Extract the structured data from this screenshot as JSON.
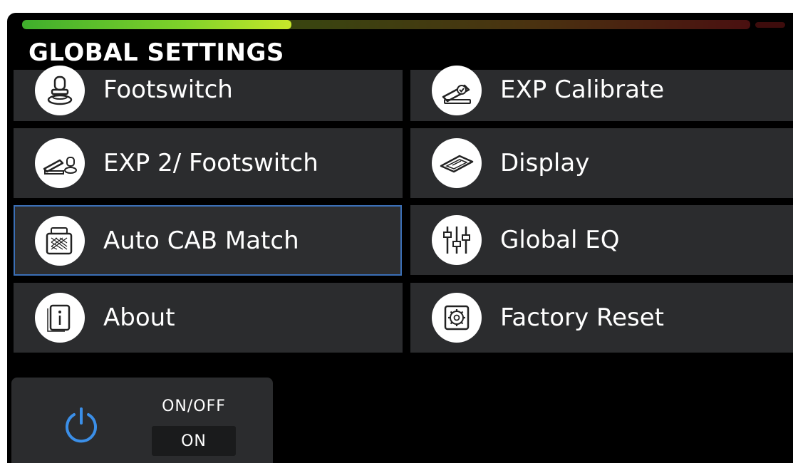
{
  "header": {
    "title": "GLOBAL SETTINGS"
  },
  "level_meter": {
    "fill_fraction": 0.37
  },
  "menu": {
    "items": [
      {
        "label": "Footswitch",
        "icon": "footswitch-icon"
      },
      {
        "label": "EXP Calibrate",
        "icon": "exp-calibrate-icon"
      },
      {
        "label": "EXP 2/ Footswitch",
        "icon": "exp-footswitch-icon"
      },
      {
        "label": "Display",
        "icon": "display-icon"
      },
      {
        "label": "Auto CAB Match",
        "icon": "cab-icon",
        "selected": true
      },
      {
        "label": "Global EQ",
        "icon": "eq-sliders-icon"
      },
      {
        "label": "About",
        "icon": "info-icon"
      },
      {
        "label": "Factory Reset",
        "icon": "factory-reset-icon"
      }
    ]
  },
  "power": {
    "label": "ON/OFF",
    "value": "ON",
    "icon": "power-icon"
  },
  "colors": {
    "background": "#000000",
    "tile": "#2b2c2e",
    "selected_border": "#3b6fb6",
    "power_blue": "#3b8fe8",
    "meter_green": "#7fd22a"
  }
}
